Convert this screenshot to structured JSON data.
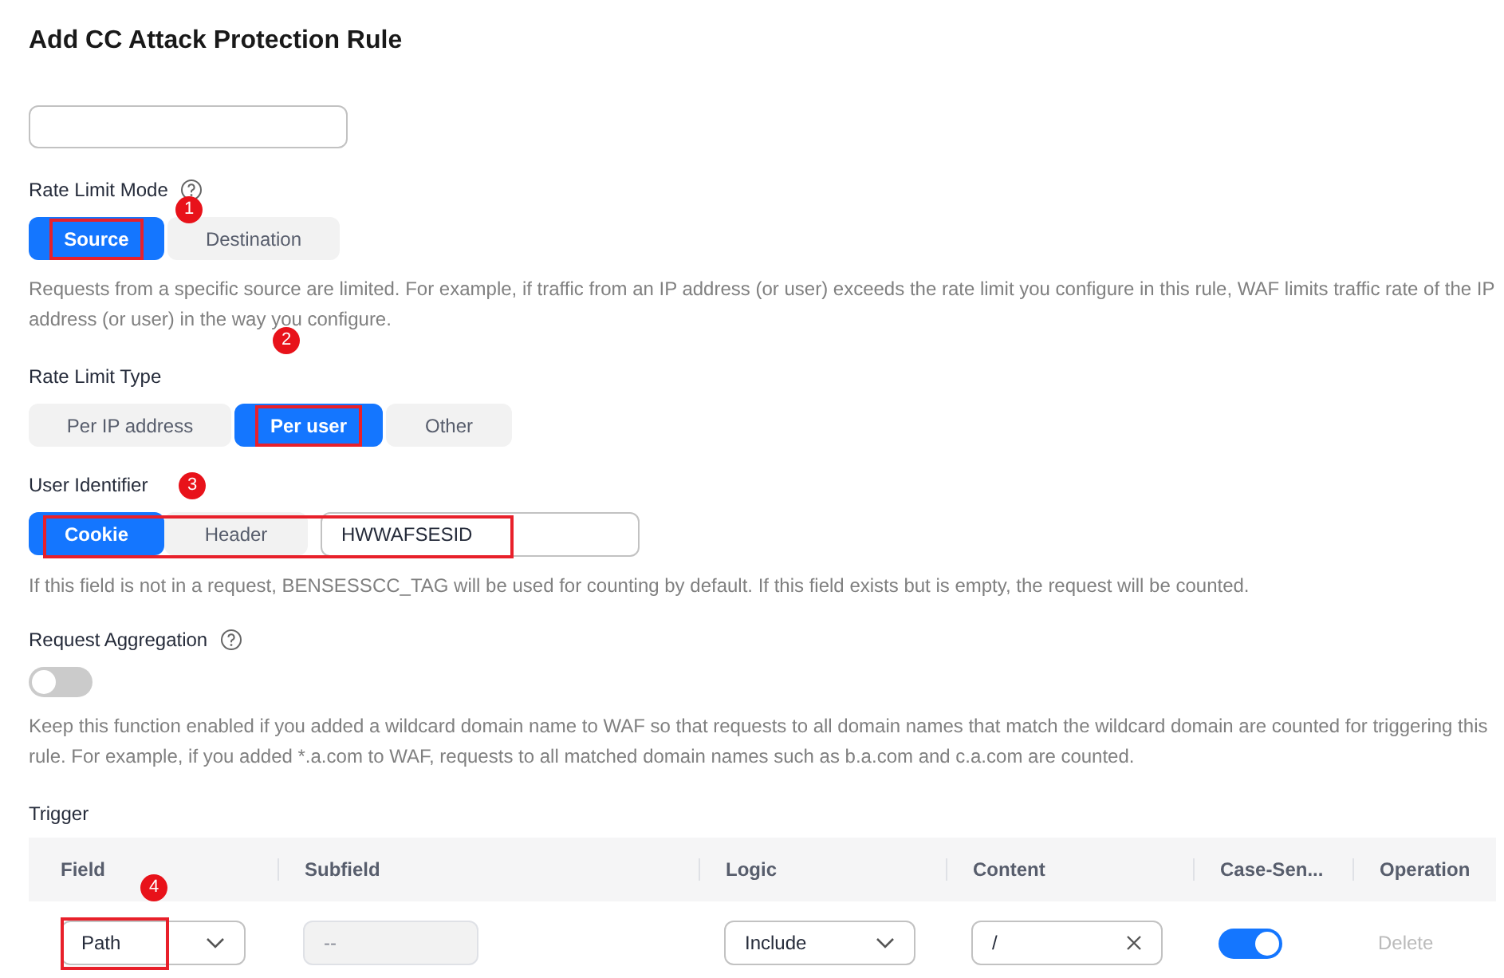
{
  "title": "Add CC Attack Protection Rule",
  "rate_limit_mode": {
    "label": "Rate Limit Mode",
    "help": true,
    "badge": "1",
    "options": [
      {
        "label": "Source",
        "selected": true,
        "highlighted": true
      },
      {
        "label": "Destination",
        "selected": false,
        "highlighted": false
      }
    ],
    "description": "Requests from a specific source are limited. For example, if traffic from an IP address (or user) exceeds the rate limit you configure in this rule, WAF limits traffic rate of the IP address (or user) in the way you configure."
  },
  "rate_limit_type": {
    "label": "Rate Limit Type",
    "badge": "2",
    "options": [
      {
        "label": "Per IP address",
        "selected": false,
        "highlighted": false
      },
      {
        "label": "Per user",
        "selected": true,
        "highlighted": true
      },
      {
        "label": "Other",
        "selected": false,
        "highlighted": false
      }
    ]
  },
  "user_identifier": {
    "label": "User Identifier",
    "badge": "3",
    "highlighted": true,
    "options": [
      {
        "label": "Cookie",
        "selected": true
      },
      {
        "label": "Header",
        "selected": false
      }
    ],
    "value": "HWWAFSESID",
    "description": "If this field is not in a request, BENSESSCC_TAG will be used for counting by default. If this field exists but is empty, the request will be counted."
  },
  "request_aggregation": {
    "label": "Request Aggregation",
    "help": true,
    "on": false,
    "description": "Keep this function enabled if you added a wildcard domain name to WAF so that requests to all domain names that match the wildcard domain are counted for triggering this rule. For example, if you added *.a.com to WAF, requests to all matched domain names such as b.a.com and c.a.com are counted."
  },
  "trigger": {
    "label": "Trigger",
    "columns": [
      "Field",
      "Subfield",
      "Logic",
      "Content",
      "Case-Sen...",
      "Operation"
    ],
    "rows": [
      {
        "field": "Path",
        "field_highlighted": true,
        "badge": "4",
        "subfield": "--",
        "logic": "Include",
        "content": "/",
        "case_sensitive": true,
        "operation": "Delete",
        "operation_disabled": true
      }
    ]
  }
}
